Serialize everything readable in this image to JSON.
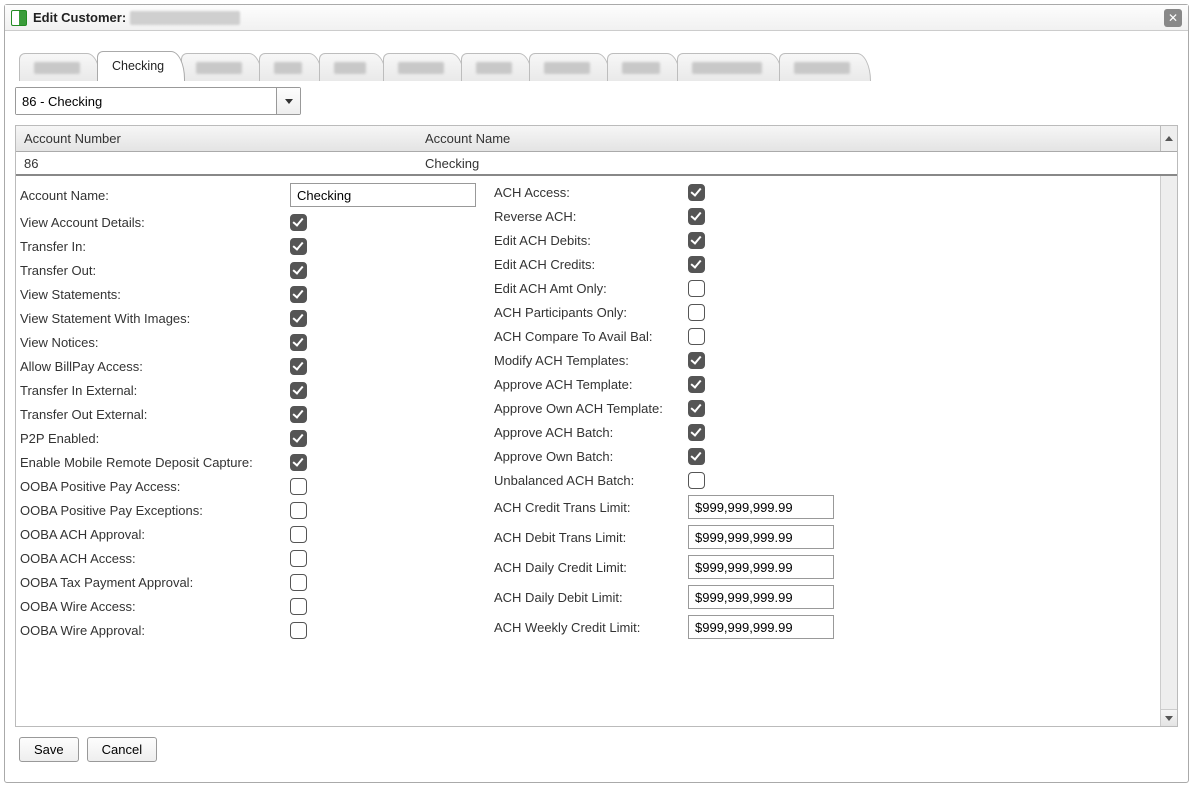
{
  "window": {
    "title": "Edit Customer:"
  },
  "tabs": {
    "active": "Checking"
  },
  "account_select": {
    "value": "86 - Checking"
  },
  "grid": {
    "headers": {
      "number": "Account Number",
      "name": "Account Name"
    },
    "row": {
      "number": "86",
      "name": "Checking"
    }
  },
  "form": {
    "account_name_label": "Account Name:",
    "account_name_value": "Checking",
    "left": [
      {
        "label": "View Account Details:",
        "checked": true
      },
      {
        "label": "Transfer In:",
        "checked": true
      },
      {
        "label": "Transfer Out:",
        "checked": true
      },
      {
        "label": "View Statements:",
        "checked": true
      },
      {
        "label": "View Statement With Images:",
        "checked": true
      },
      {
        "label": "View Notices:",
        "checked": true
      },
      {
        "label": "Allow BillPay Access:",
        "checked": true
      },
      {
        "label": "Transfer In External:",
        "checked": true
      },
      {
        "label": "Transfer Out External:",
        "checked": true
      },
      {
        "label": "P2P Enabled:",
        "checked": true
      },
      {
        "label": "Enable Mobile Remote Deposit Capture:",
        "checked": true
      },
      {
        "label": "OOBA Positive Pay Access:",
        "checked": false
      },
      {
        "label": "OOBA Positive Pay Exceptions:",
        "checked": false
      },
      {
        "label": "OOBA ACH Approval:",
        "checked": false
      },
      {
        "label": "OOBA ACH Access:",
        "checked": false
      },
      {
        "label": "OOBA Tax Payment Approval:",
        "checked": false
      },
      {
        "label": "OOBA Wire Access:",
        "checked": false
      },
      {
        "label": "OOBA Wire Approval:",
        "checked": false
      }
    ],
    "right_checks": [
      {
        "label": "ACH Access:",
        "checked": true
      },
      {
        "label": "Reverse ACH:",
        "checked": true
      },
      {
        "label": "Edit ACH Debits:",
        "checked": true
      },
      {
        "label": "Edit ACH Credits:",
        "checked": true
      },
      {
        "label": "Edit ACH Amt Only:",
        "checked": false
      },
      {
        "label": "ACH Participants Only:",
        "checked": false
      },
      {
        "label": "ACH Compare To Avail Bal:",
        "checked": false
      },
      {
        "label": "Modify ACH Templates:",
        "checked": true
      },
      {
        "label": "Approve ACH Template:",
        "checked": true
      },
      {
        "label": "Approve Own ACH Template:",
        "checked": true
      },
      {
        "label": "Approve ACH Batch:",
        "checked": true
      },
      {
        "label": "Approve Own Batch:",
        "checked": true
      },
      {
        "label": "Unbalanced ACH Batch:",
        "checked": false
      }
    ],
    "right_texts": [
      {
        "label": "ACH Credit Trans Limit:",
        "value": "$999,999,999.99"
      },
      {
        "label": "ACH Debit Trans Limit:",
        "value": "$999,999,999.99"
      },
      {
        "label": "ACH Daily Credit Limit:",
        "value": "$999,999,999.99"
      },
      {
        "label": "ACH Daily Debit Limit:",
        "value": "$999,999,999.99"
      },
      {
        "label": "ACH Weekly Credit Limit:",
        "value": "$999,999,999.99"
      }
    ]
  },
  "buttons": {
    "save": "Save",
    "cancel": "Cancel"
  }
}
